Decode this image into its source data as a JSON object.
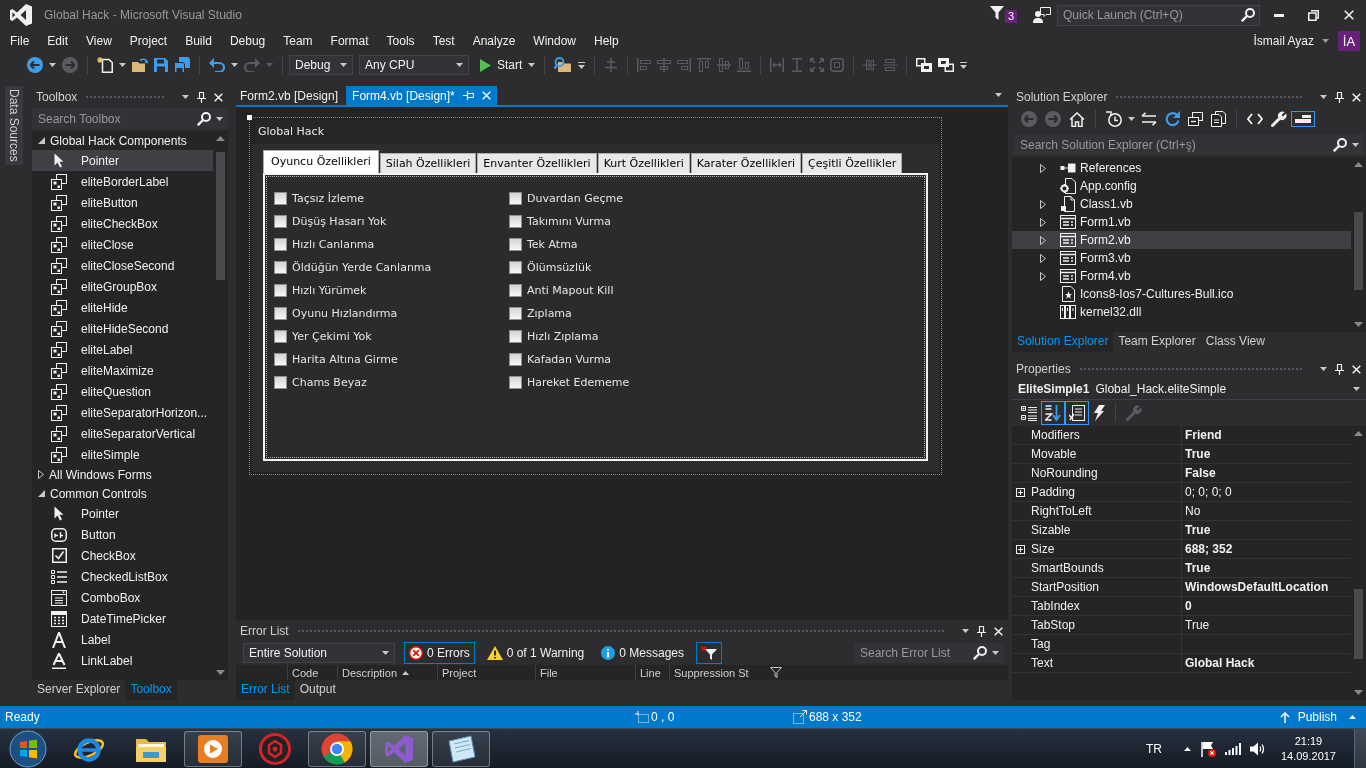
{
  "window": {
    "title": "Global Hack - Microsoft Visual Studio",
    "notification_count": "3",
    "quick_launch": {
      "placeholder": "Quick Launch (Ctrl+Q)"
    }
  },
  "menu": {
    "items": [
      "File",
      "Edit",
      "View",
      "Project",
      "Build",
      "Debug",
      "Team",
      "Format",
      "Tools",
      "Test",
      "Analyze",
      "Window",
      "Help"
    ],
    "user": {
      "name": "İsmail Ayaz",
      "initials": "İA"
    }
  },
  "toolbar": [
    {
      "kind": "back",
      "disabled": false
    },
    {
      "kind": "dropdown",
      "disabled": false
    },
    {
      "kind": "forward",
      "disabled": true
    },
    {
      "kind": "separator"
    },
    {
      "kind": "new-project",
      "disabled": false
    },
    {
      "kind": "dropdown",
      "disabled": false
    },
    {
      "kind": "open",
      "disabled": false
    },
    {
      "kind": "save",
      "disabled": false
    },
    {
      "kind": "save-all",
      "disabled": false
    },
    {
      "kind": "separator"
    },
    {
      "kind": "undo",
      "disabled": false
    },
    {
      "kind": "dropdown",
      "disabled": false
    },
    {
      "kind": "redo",
      "disabled": true
    },
    {
      "kind": "dropdown",
      "disabled": true
    },
    {
      "kind": "separator"
    },
    {
      "kind": "configuration",
      "value": "Debug",
      "disabled": false
    },
    {
      "kind": "platform",
      "value": "Any CPU",
      "disabled": false
    },
    {
      "kind": "start",
      "label": "Start",
      "disabled": false
    },
    {
      "kind": "separator"
    },
    {
      "kind": "find",
      "disabled": false
    },
    {
      "kind": "overflow",
      "disabled": false
    },
    {
      "kind": "separator"
    },
    {
      "kind": "align-grid",
      "disabled": true
    },
    {
      "kind": "separator"
    },
    {
      "kind": "align-left",
      "disabled": true
    },
    {
      "kind": "align-center",
      "disabled": true
    },
    {
      "kind": "align-right",
      "disabled": true
    },
    {
      "kind": "align-top",
      "disabled": true
    },
    {
      "kind": "align-middle",
      "disabled": true
    },
    {
      "kind": "align-bottom",
      "disabled": true
    },
    {
      "kind": "separator"
    },
    {
      "kind": "same-width",
      "disabled": true
    },
    {
      "kind": "same-height",
      "disabled": true
    },
    {
      "kind": "same-size",
      "disabled": true
    },
    {
      "kind": "size-grid",
      "disabled": true
    },
    {
      "kind": "separator"
    },
    {
      "kind": "center-horizontal",
      "disabled": true
    },
    {
      "kind": "center-vertical",
      "disabled": true
    },
    {
      "kind": "separator"
    },
    {
      "kind": "bring-front",
      "disabled": false
    },
    {
      "kind": "send-back",
      "disabled": false
    },
    {
      "kind": "overflow",
      "disabled": false
    }
  ],
  "side_tabs": [
    "Data Sources"
  ],
  "toolbox": {
    "title": "Toolbox",
    "search": {
      "placeholder": "Search Toolbox"
    },
    "groups": [
      {
        "label": "Global Hack Components",
        "expanded": true,
        "items": [
          {
            "label": "Pointer",
            "kind": "pointer",
            "selected": true
          },
          {
            "label": "eliteBorderLabel",
            "kind": "component",
            "selected": false
          },
          {
            "label": "eliteButton",
            "kind": "component",
            "selected": false
          },
          {
            "label": "eliteCheckBox",
            "kind": "component",
            "selected": false
          },
          {
            "label": "eliteClose",
            "kind": "component",
            "selected": false
          },
          {
            "label": "eliteCloseSecond",
            "kind": "component",
            "selected": false
          },
          {
            "label": "eliteGroupBox",
            "kind": "component",
            "selected": false
          },
          {
            "label": "eliteHide",
            "kind": "component",
            "selected": false
          },
          {
            "label": "eliteHideSecond",
            "kind": "component",
            "selected": false
          },
          {
            "label": "eliteLabel",
            "kind": "component",
            "selected": false
          },
          {
            "label": "eliteMaximize",
            "kind": "component",
            "selected": false
          },
          {
            "label": "eliteQuestion",
            "kind": "component",
            "selected": false
          },
          {
            "label": "eliteSeparatorHorizon...",
            "kind": "component",
            "selected": false
          },
          {
            "label": "eliteSeparatorVertical",
            "kind": "component",
            "selected": false
          },
          {
            "label": "eliteSimple",
            "kind": "component",
            "selected": false
          }
        ]
      },
      {
        "label": "All Windows Forms",
        "expanded": false
      },
      {
        "label": "Common Controls",
        "expanded": true,
        "items": [
          {
            "label": "Pointer",
            "kind": "pointer",
            "selected": false
          },
          {
            "label": "Button",
            "kind": "button",
            "selected": false
          },
          {
            "label": "CheckBox",
            "kind": "checkbox",
            "selected": false
          },
          {
            "label": "CheckedListBox",
            "kind": "checkedlistbox",
            "selected": false
          },
          {
            "label": "ComboBox",
            "kind": "combobox",
            "selected": false
          },
          {
            "label": "DateTimePicker",
            "kind": "datetimepicker",
            "selected": false
          },
          {
            "label": "Label",
            "kind": "label",
            "selected": false
          },
          {
            "label": "LinkLabel",
            "kind": "linklabel",
            "selected": false
          }
        ]
      }
    ],
    "tabs": [
      {
        "label": "Server Explorer",
        "selected": false
      },
      {
        "label": "Toolbox",
        "selected": true
      }
    ]
  },
  "document_tabs": [
    {
      "label": "Form2.vb [Design]",
      "selected": false
    },
    {
      "label": "Form4.vb [Design]*",
      "selected": true
    }
  ],
  "designer": {
    "form": {
      "title": "Global Hack",
      "tabs": [
        {
          "label": "Oyuncu Özellikleri",
          "selected": true
        },
        {
          "label": "Silah Özellikleri",
          "selected": false
        },
        {
          "label": "Envanter Özellikleri",
          "selected": false
        },
        {
          "label": "Kurt Özellikleri",
          "selected": false
        },
        {
          "label": "Karater Özellikleri",
          "selected": false
        },
        {
          "label": "Çeşitli Özellikler",
          "selected": false
        }
      ],
      "columns": [
        {
          "items": [
            {
              "label": "Taçsız İzleme",
              "checked": false
            },
            {
              "label": "Düşüş Hasarı Yok",
              "checked": false
            },
            {
              "label": "Hızlı Canlanma",
              "checked": false
            },
            {
              "label": "Öldüğün Yerde Canlanma",
              "checked": false
            },
            {
              "label": "Hızlı Yürümek",
              "checked": false
            },
            {
              "label": "Oyunu Hızlandırma",
              "checked": false
            },
            {
              "label": "Yer Çekimi Yok",
              "checked": false
            },
            {
              "label": "Harita Altına Girme",
              "checked": false
            },
            {
              "label": "Chams Beyaz",
              "checked": false
            }
          ]
        },
        {
          "items": [
            {
              "label": "Duvardan Geçme",
              "checked": false
            },
            {
              "label": "Takımını Vurma",
              "checked": false
            },
            {
              "label": "Tek Atma",
              "checked": false
            },
            {
              "label": "Ölümsüzlük",
              "checked": false
            },
            {
              "label": "Anti Mapout Kill",
              "checked": false
            },
            {
              "label": "Zıplama",
              "checked": false
            },
            {
              "label": "Hızlı Zıplama",
              "checked": false
            },
            {
              "label": "Kafadan Vurma",
              "checked": false
            },
            {
              "label": "Hareket Edememe",
              "checked": false
            }
          ]
        }
      ]
    }
  },
  "error_list": {
    "title": "Error List",
    "scope": "Entire Solution",
    "filters": [
      {
        "kind": "errors",
        "label": "0 Errors",
        "selected": true
      },
      {
        "kind": "warnings",
        "label": "0 of 1 Warning",
        "selected": false
      },
      {
        "kind": "messages",
        "label": "0 Messages",
        "selected": false
      },
      {
        "kind": "filter",
        "selected": true
      }
    ],
    "search": {
      "placeholder": "Search Error List"
    },
    "columns": [
      {
        "label": "Code",
        "sorted": false
      },
      {
        "label": "Description",
        "sorted": true
      },
      {
        "label": "Project",
        "sorted": false
      },
      {
        "label": "File",
        "sorted": false
      },
      {
        "label": "Line",
        "sorted": false
      },
      {
        "label": "Suppression St",
        "sorted": false
      }
    ],
    "tabs": [
      {
        "label": "Error List",
        "selected": true
      },
      {
        "label": "Output",
        "selected": false
      }
    ]
  },
  "solution_explorer": {
    "title": "Solution Explorer",
    "toolbar": [
      {
        "kind": "back",
        "disabled": true,
        "selected": false
      },
      {
        "kind": "forward",
        "disabled": true,
        "selected": false
      },
      {
        "kind": "home",
        "disabled": false,
        "selected": false
      },
      {
        "kind": "separator"
      },
      {
        "kind": "history",
        "disabled": false,
        "selected": false
      },
      {
        "kind": "dropdown",
        "disabled": false,
        "selected": false
      },
      {
        "kind": "sync",
        "disabled": false,
        "selected": false
      },
      {
        "kind": "refresh",
        "disabled": false,
        "selected": false
      },
      {
        "kind": "collapse-all",
        "disabled": false,
        "selected": false
      },
      {
        "kind": "show-all",
        "disabled": false,
        "selected": false
      },
      {
        "kind": "separator"
      },
      {
        "kind": "code",
        "disabled": false,
        "selected": false
      },
      {
        "kind": "properties",
        "disabled": false,
        "selected": false
      },
      {
        "kind": "preview",
        "disabled": false,
        "selected": true
      }
    ],
    "search": {
      "placeholder": "Search Solution Explorer (Ctrl+ş)"
    },
    "items": [
      {
        "label": "References",
        "kind": "references",
        "expanded": false,
        "selected": false
      },
      {
        "label": "App.config",
        "kind": "config",
        "selected": false
      },
      {
        "label": "Class1.vb",
        "kind": "class",
        "expanded": false,
        "selected": false
      },
      {
        "label": "Form1.vb",
        "kind": "form",
        "expanded": false,
        "selected": false
      },
      {
        "label": "Form2.vb",
        "kind": "form",
        "expanded": false,
        "selected": true
      },
      {
        "label": "Form3.vb",
        "kind": "form",
        "expanded": false,
        "selected": false
      },
      {
        "label": "Form4.vb",
        "kind": "form",
        "expanded": false,
        "selected": false
      },
      {
        "label": "Icons8-Ios7-Cultures-Bull.ico",
        "kind": "icon-file",
        "selected": false
      },
      {
        "label": "kernel32.dll",
        "kind": "library",
        "selected": false
      }
    ],
    "tabs": [
      {
        "label": "Solution Explorer",
        "selected": true
      },
      {
        "label": "Team Explorer",
        "selected": false
      },
      {
        "label": "Class View",
        "selected": false
      }
    ]
  },
  "properties": {
    "title": "Properties",
    "object": {
      "name": "EliteSimple1",
      "type": "Global_Hack.eliteSimple"
    },
    "toolbar": [
      {
        "kind": "categorized",
        "disabled": false,
        "selected": false
      },
      {
        "kind": "alphabetical",
        "disabled": false,
        "selected": true
      },
      {
        "kind": "property-grid",
        "disabled": false,
        "selected": true
      },
      {
        "kind": "events",
        "disabled": false,
        "selected": false
      },
      {
        "kind": "separator"
      },
      {
        "kind": "property-pages",
        "disabled": true,
        "selected": false
      }
    ],
    "rows": [
      {
        "name": "Modifiers",
        "value": "Friend",
        "modified": true,
        "expandable": false
      },
      {
        "name": "Movable",
        "value": "True",
        "modified": true,
        "expandable": false
      },
      {
        "name": "NoRounding",
        "value": "False",
        "modified": true,
        "expandable": false
      },
      {
        "name": "Padding",
        "value": "0; 0; 0; 0",
        "modified": false,
        "expandable": true
      },
      {
        "name": "RightToLeft",
        "value": "No",
        "modified": false,
        "expandable": false
      },
      {
        "name": "Sizable",
        "value": "True",
        "modified": true,
        "expandable": false
      },
      {
        "name": "Size",
        "value": "688; 352",
        "modified": true,
        "expandable": true
      },
      {
        "name": "SmartBounds",
        "value": "True",
        "modified": true,
        "expandable": false
      },
      {
        "name": "StartPosition",
        "value": "WindowsDefaultLocation",
        "modified": true,
        "expandable": false
      },
      {
        "name": "TabIndex",
        "value": "0",
        "modified": true,
        "expandable": false
      },
      {
        "name": "TabStop",
        "value": "True",
        "modified": false,
        "expandable": false
      },
      {
        "name": "Tag",
        "expandable": false
      },
      {
        "name": "Text",
        "value": "Global Hack",
        "modified": true,
        "expandable": false
      }
    ]
  },
  "status_bar": {
    "text": "Ready",
    "position": "0 , 0",
    "size": "688 x 352",
    "publish": "Publish"
  },
  "taskbar": {
    "apps": [
      {
        "kind": "browser",
        "running": false,
        "selected": false
      },
      {
        "kind": "folder",
        "running": false,
        "selected": false
      },
      {
        "kind": "media",
        "running": true,
        "selected": false
      },
      {
        "kind": "security",
        "running": false,
        "selected": false
      },
      {
        "kind": "web",
        "running": true,
        "selected": false
      },
      {
        "kind": "studio",
        "running": true,
        "selected": true
      },
      {
        "kind": "notes",
        "running": true,
        "selected": false
      }
    ],
    "language": "TR",
    "time": "21:19",
    "date": "14.09.2017"
  }
}
